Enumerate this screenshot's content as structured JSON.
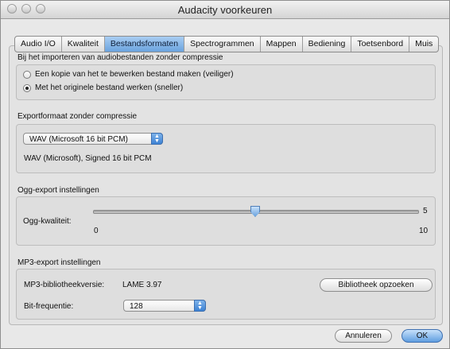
{
  "window": {
    "title": "Audacity voorkeuren"
  },
  "tabs": [
    "Audio I/O",
    "Kwaliteit",
    "Bestandsformaten",
    "Spectrogrammen",
    "Mappen",
    "Bediening",
    "Toetsenbord",
    "Muis"
  ],
  "active_tab": "Bestandsformaten",
  "import_section": {
    "title": "Bij het importeren van audiobestanden zonder compressie",
    "option_copy": "Een kopie van het te bewerken bestand maken (veiliger)",
    "option_direct": "Met het originele bestand werken (sneller)",
    "selected": "option_direct"
  },
  "export_section": {
    "title": "Exportformaat zonder compressie",
    "format_value": "WAV (Microsoft 16 bit PCM)",
    "format_description": "WAV (Microsoft), Signed 16 bit PCM"
  },
  "ogg_section": {
    "title": "Ogg-export instellingen",
    "quality_label": "Ogg-kwaliteit:",
    "quality_value": "5",
    "quality_fraction": 0.5,
    "min_label": "0",
    "max_label": "10"
  },
  "mp3_section": {
    "title": "MP3-export instellingen",
    "library_label": "MP3-bibliotheekversie:",
    "library_value": "LAME 3.97",
    "find_library_button": "Bibliotheek opzoeken",
    "bitrate_label": "Bit-frequentie:",
    "bitrate_value": "128"
  },
  "footer": {
    "cancel_label": "Annuleren",
    "ok_label": "OK"
  }
}
